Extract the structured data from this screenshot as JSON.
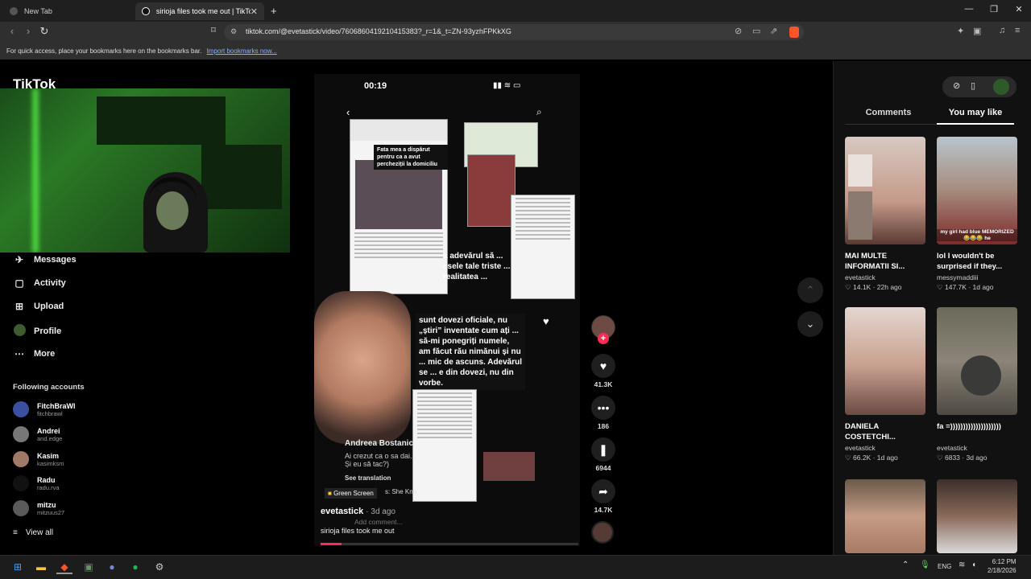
{
  "browser": {
    "tabs": [
      {
        "label": "New Tab"
      },
      {
        "label": "sirioja files took me out | TikTok"
      }
    ],
    "url": "tiktok.com/@evetastick/video/7606860419210415383?_r=1&_t=ZN-93yzhFPKkXG",
    "bookmarks_text": "For quick access, place your bookmarks here on the bookmarks bar.",
    "bookmarks_link": "Import bookmarks now..."
  },
  "sidebar": {
    "logo": "TikTok",
    "items": [
      {
        "label": "Messages",
        "icon": "message-icon"
      },
      {
        "label": "Activity",
        "icon": "activity-icon"
      },
      {
        "label": "Upload",
        "icon": "upload-icon"
      },
      {
        "label": "Profile",
        "icon": "profile-avatar"
      },
      {
        "label": "More",
        "icon": "more-icon"
      }
    ],
    "following_title": "Following accounts",
    "accounts": [
      {
        "name": "FitchBraWl",
        "handle": "fitchbrawl",
        "color": "#3a4fa0"
      },
      {
        "name": "Andrei",
        "handle": "and.edge",
        "color": "#777777"
      },
      {
        "name": "Kasim",
        "handle": "kasimksm",
        "color": "#a07a66"
      },
      {
        "name": "Radu",
        "handle": "radu.rva",
        "color": "#111111"
      },
      {
        "name": "mitzu",
        "handle": "mitzuus27",
        "color": "#5a5a5a"
      }
    ],
    "view_all": "View all"
  },
  "video": {
    "phone_time": "00:19",
    "overlay_caption_1": "Fata mea a dispărut pentru ca a avut percheziții la domiciliu",
    "overlay_caption_2": "a adevărul să ... esele tale triste ... realitatea ...",
    "overlay_text": "sunt dovezi oficiale, nu „știri” inventate cum ați ... să-mi ponegriți numele, am făcut rău nimănui și nu ... mic de ascuns. Adevărul se ... e din dovezi, nu din vorbe.",
    "username": "Andreea Bostanic",
    "description": "Ai crezut ca o sa dai... Și eu să tac?)",
    "see_translation": "See translation",
    "green_screen": "Green Screen",
    "sound": "s: She Kno",
    "author": "evetastick",
    "date": "· 3d ago",
    "add_comment_placeholder": "Add comment...",
    "title": "sirioja files took me out",
    "progress": 0.08
  },
  "actions": {
    "likes": "41.3K",
    "comments": "186",
    "saves": "6944",
    "shares": "14.7K"
  },
  "right_panel": {
    "tabs": [
      "Comments",
      "You may like"
    ],
    "active_tab": "You may like",
    "recommendations": [
      {
        "title": "MAI MULTE INFORMATII SI...",
        "user": "evetastick",
        "likes": "14.1K",
        "age": "22h ago",
        "thumb_overlay": ""
      },
      {
        "title": "lol I wouldn't be surprised if they...",
        "user": "messymaddiii",
        "likes": "147.7K",
        "age": "1d ago",
        "thumb_overlay": "my girl had blue MEMORIZED 😂😂😂 he"
      },
      {
        "title": "DANIELA COSTETCHI...",
        "user": "evetastick",
        "likes": "66.2K",
        "age": "1d ago",
        "thumb_overlay": ""
      },
      {
        "title": "fa =))))))))))))))))))))",
        "user": "evetastick",
        "likes": "6833",
        "age": "3d ago",
        "thumb_overlay": ""
      },
      {
        "title": "",
        "user": "",
        "likes": "",
        "age": "",
        "thumb_overlay": ""
      },
      {
        "title": "",
        "user": "",
        "likes": "",
        "age": "",
        "thumb_overlay": ""
      }
    ]
  },
  "taskbar": {
    "language": "ENG",
    "time": "6:12 PM",
    "date": "2/18/2026"
  },
  "colors": {
    "accent": "#fe2c55",
    "background": "#000000"
  }
}
